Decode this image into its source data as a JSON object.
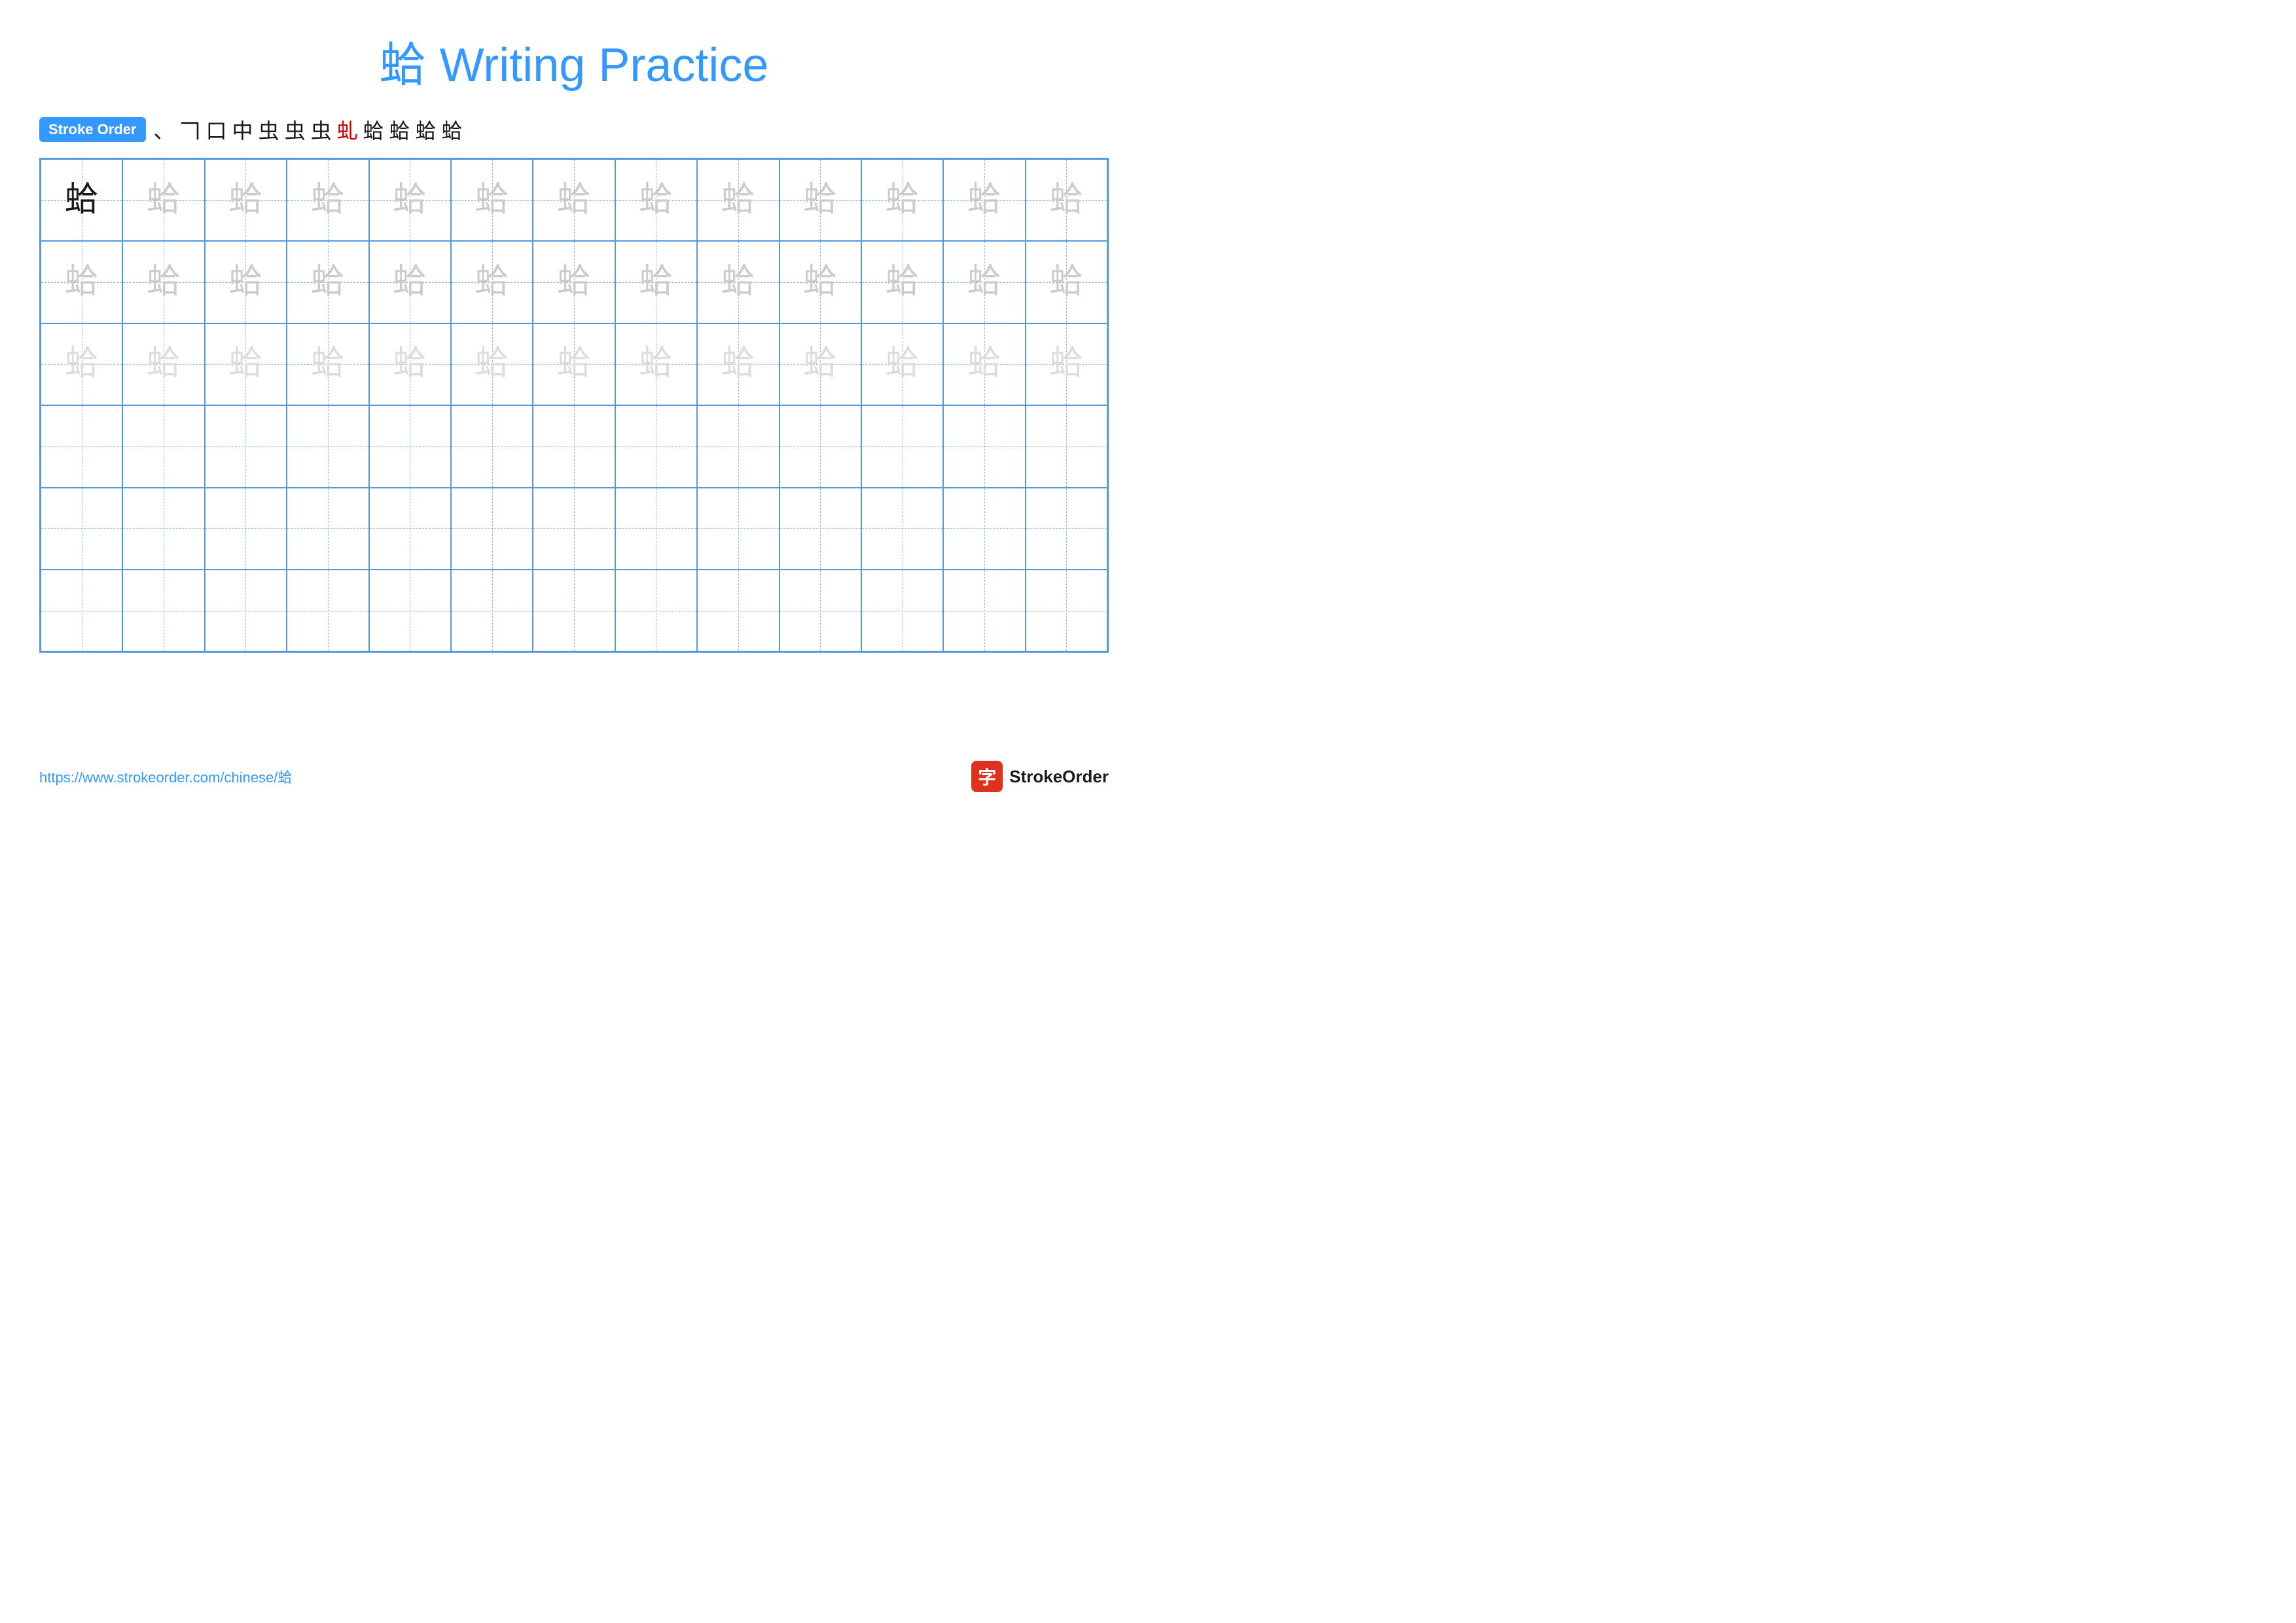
{
  "title": "蛤 Writing Practice",
  "stroke_order": {
    "label": "Stroke Order",
    "strokes": [
      "、",
      "𠃍",
      "口",
      "中",
      "虫",
      "虫",
      "虫",
      "虬",
      "蛤",
      "蛤",
      "蛤",
      "蛤"
    ]
  },
  "character": "蛤",
  "rows": [
    {
      "type": "dark_then_light",
      "first_dark": true
    },
    {
      "type": "light"
    },
    {
      "type": "lighter"
    },
    {
      "type": "empty"
    },
    {
      "type": "empty"
    },
    {
      "type": "empty"
    }
  ],
  "cols": 13,
  "footer": {
    "url": "https://www.strokeorder.com/chinese/蛤",
    "logo_text": "StrokeOrder",
    "logo_icon": "字"
  }
}
